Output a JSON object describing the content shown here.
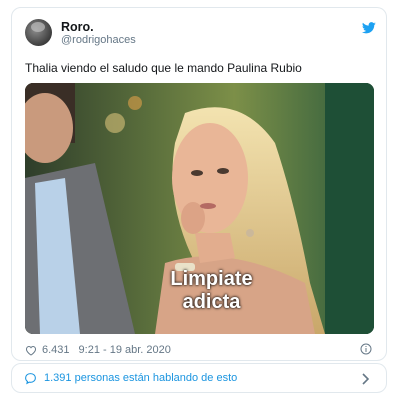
{
  "author": {
    "display_name": "Roro.",
    "handle": "@rodrigohaces"
  },
  "tweet": {
    "text": "Thalia viendo el saludo que le mando Paulina Rubio",
    "media_caption_line1": "Limpiate",
    "media_caption_line2": "adicta",
    "likes": "6.431",
    "timestamp": "9:21 - 19 abr. 2020"
  },
  "conversation": {
    "text": "1.391 personas están hablando de esto"
  },
  "colors": {
    "accent": "#1da1f2",
    "link": "#1b95e0",
    "secondary_text": "#657786",
    "border": "#e1e8ed"
  },
  "icons": [
    "twitter-bird-icon",
    "heart-icon",
    "info-icon",
    "chat-bubble-icon",
    "chevron-right-icon"
  ]
}
